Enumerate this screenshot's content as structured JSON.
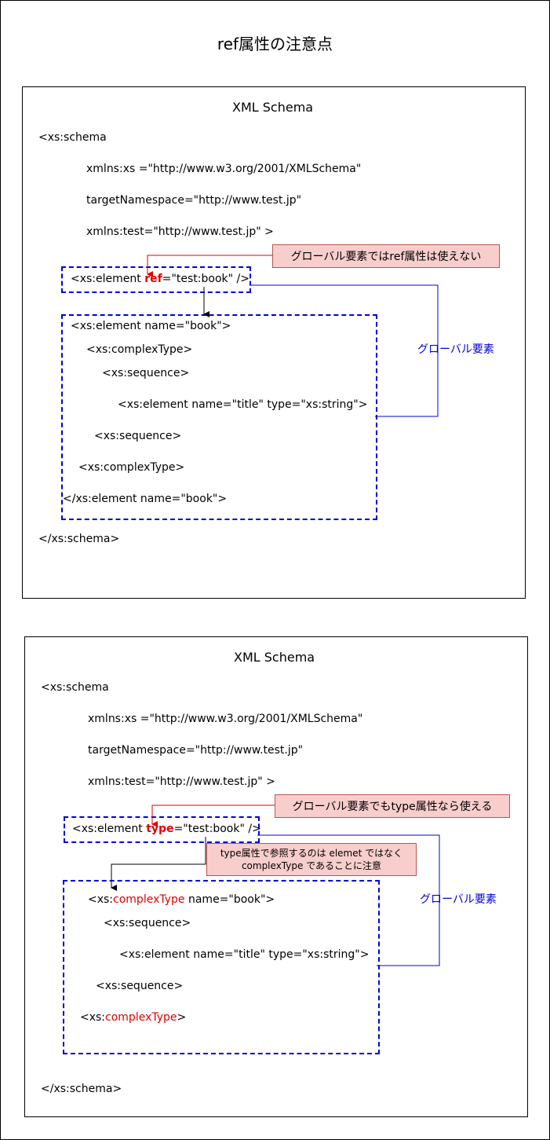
{
  "title": "ref属性の注意点",
  "panel1": {
    "heading": "XML Schema",
    "schema_open": "<xs:schema",
    "ns_xs": "xmlns:xs =\"http://www.w3.org/2001/XMLSchema\"",
    "target_ns": "targetNamespace=\"http://www.test.jp\"",
    "ns_test": "xmlns:test=\"http://www.test.jp\" >",
    "ref_prefix": "<xs:element ",
    "ref_keyword": "ref",
    "ref_suffix": "=\"test:book\" />",
    "callout": "グローバル要素ではref属性は使えない",
    "global_label": "グローバル要素",
    "lines": [
      "<xs:element name=\"book\">",
      "<xs:complexType>",
      "<xs:sequence>",
      "<xs:element name=\"title\" type=\"xs:string\">",
      "<xs:sequence>",
      "<xs:complexType>",
      "</xs:element name=\"book\">"
    ],
    "schema_close": "</xs:schema>"
  },
  "panel2": {
    "heading": "XML Schema",
    "schema_open": "<xs:schema",
    "ns_xs": "xmlns:xs =\"http://www.w3.org/2001/XMLSchema\"",
    "target_ns": "targetNamespace=\"http://www.test.jp\"",
    "ns_test": "xmlns:test=\"http://www.test.jp\" >",
    "type_prefix": "<xs:element ",
    "type_keyword": "type",
    "type_suffix": "=\"test:book\" />",
    "callout": "グローバル要素でもtype属性なら使える",
    "note_line1": "type属性で参照するのは elemet ではなく",
    "note_line2": "complexType であることに注意",
    "global_label": "グローバル要素",
    "ct_prefix": "<xs:",
    "ct_keyword": "complexType",
    "ct_suffix": " name=\"book\">",
    "seq_open": "<xs:sequence>",
    "elem_title": "<xs:element name=\"title\" type=\"xs:string\">",
    "seq_close": "<xs:sequence>",
    "ct_close_prefix": "<xs:",
    "ct_close_keyword": "complexType",
    "ct_close_suffix": ">",
    "schema_close": "</xs:schema>"
  },
  "colors": {
    "accent_red": "#e00000",
    "dash_blue": "#0000dd",
    "callout_fill": "#f8cecc",
    "callout_border": "#b85450"
  }
}
